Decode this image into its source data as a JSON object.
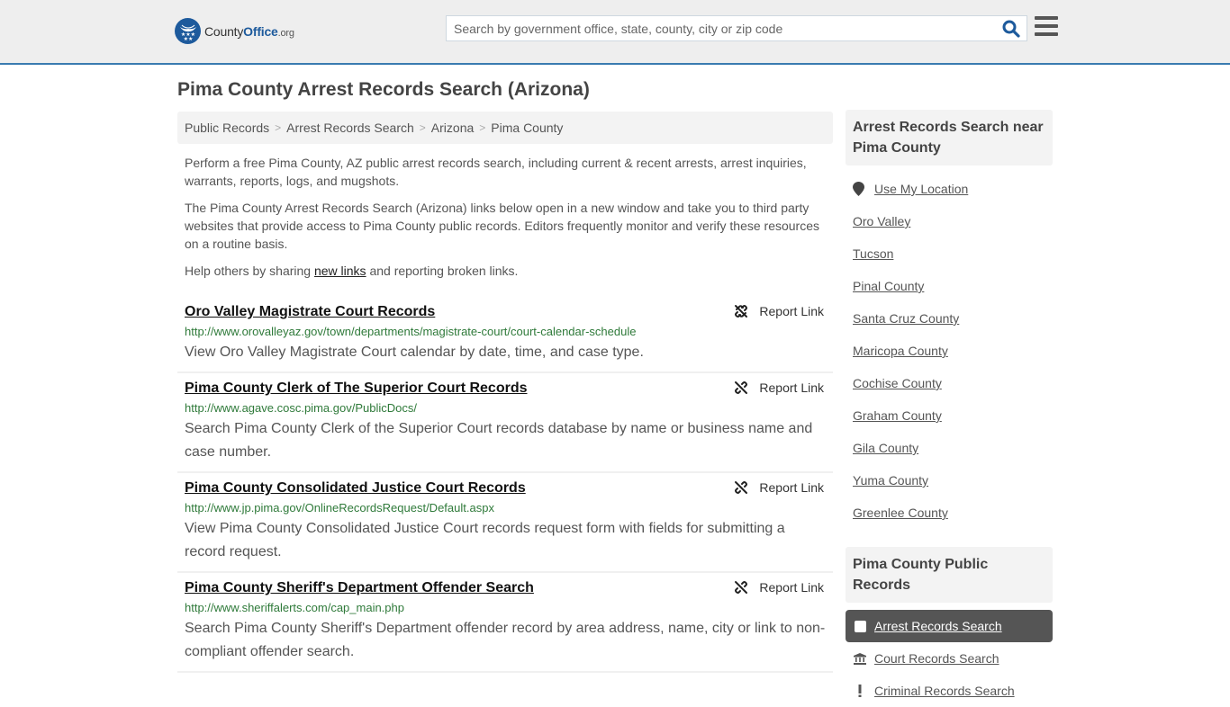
{
  "header": {
    "logo": {
      "county": "County",
      "office": "Office",
      "org": ".org"
    },
    "search_placeholder": "Search by government office, state, county, city or zip code",
    "search_value": ""
  },
  "page_title": "Pima County Arrest Records Search (Arizona)",
  "breadcrumb": [
    {
      "label": "Public Records"
    },
    {
      "label": "Arrest Records Search"
    },
    {
      "label": "Arizona"
    },
    {
      "label": "Pima County"
    }
  ],
  "intro": {
    "p1": "Perform a free Pima County, AZ public arrest records search, including current & recent arrests, arrest inquiries, warrants, reports, logs, and mugshots.",
    "p2": "The Pima County Arrest Records Search (Arizona) links below open in a new window and take you to third party websites that provide access to Pima County public records. Editors frequently monitor and verify these resources on a routine basis.",
    "p3_before": "Help others by sharing ",
    "p3_link": "new links",
    "p3_after": " and reporting broken links."
  },
  "report_label": "Report Link",
  "records": [
    {
      "title": "Oro Valley Magistrate Court Records",
      "url": "http://www.orovalleyaz.gov/town/departments/magistrate-court/court-calendar-schedule",
      "desc": "View Oro Valley Magistrate Court calendar by date, time, and case type."
    },
    {
      "title": "Pima County Clerk of The Superior Court Records",
      "url": "http://www.agave.cosc.pima.gov/PublicDocs/",
      "desc": "Search Pima County Clerk of the Superior Court records database by name or business name and case number."
    },
    {
      "title": "Pima County Consolidated Justice Court Records",
      "url": "http://www.jp.pima.gov/OnlineRecordsRequest/Default.aspx",
      "desc": "View Pima County Consolidated Justice Court records request form with fields for submitting a record request."
    },
    {
      "title": "Pima County Sheriff's Department Offender Search",
      "url": "http://www.sheriffalerts.com/cap_main.php",
      "desc": "Search Pima County Sheriff's Department offender record by area address, name, city or link to non-compliant offender search."
    }
  ],
  "sidebar": {
    "nearby_heading": "Arrest Records Search near Pima County",
    "use_location": "Use My Location",
    "nearby": [
      "Oro Valley",
      "Tucson",
      "Pinal County",
      "Santa Cruz County",
      "Maricopa County",
      "Cochise County",
      "Graham County",
      "Gila County",
      "Yuma County",
      "Greenlee County"
    ],
    "public_records_heading": "Pima County Public Records",
    "public_records": [
      {
        "label": "Arrest Records Search",
        "icon": "checkbox-icon",
        "active": true
      },
      {
        "label": "Court Records Search",
        "icon": "courthouse-icon",
        "active": false
      },
      {
        "label": "Criminal Records Search",
        "icon": "exclamation-icon",
        "active": false
      }
    ]
  },
  "colors": {
    "brand_blue": "#1d5a9c",
    "header_border": "#3a7bb0",
    "url_green": "#2f7a3a",
    "active_item_bg": "#555555"
  }
}
